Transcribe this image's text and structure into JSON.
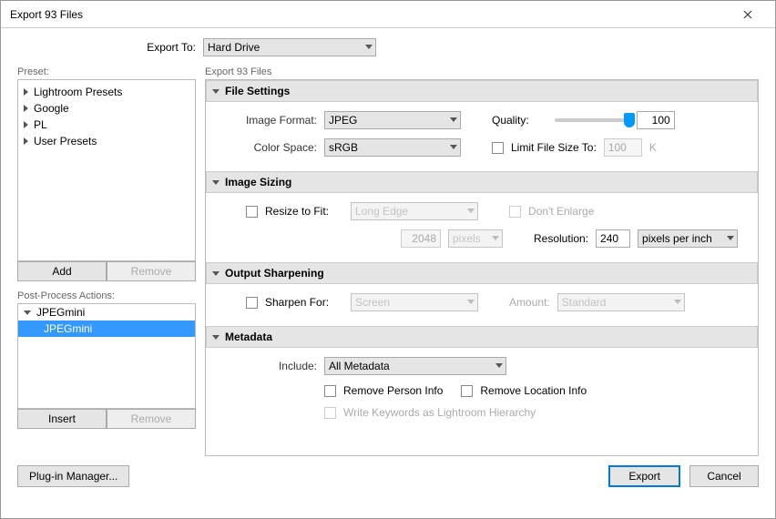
{
  "window": {
    "title": "Export 93 Files"
  },
  "exportTo": {
    "label": "Export To:",
    "value": "Hard Drive"
  },
  "preset": {
    "label": "Preset:",
    "items": [
      "Lightroom Presets",
      "Google",
      "PL",
      "User Presets"
    ],
    "add": "Add",
    "remove": "Remove"
  },
  "actions": {
    "label": "Post-Process Actions:",
    "group": "JPEGmini",
    "child": "JPEGmini",
    "insert": "Insert",
    "remove": "Remove"
  },
  "mainLabel": "Export 93 Files",
  "sections": {
    "fileSettings": {
      "title": "File Settings",
      "imageFormatLabel": "Image Format:",
      "imageFormat": "JPEG",
      "colorSpaceLabel": "Color Space:",
      "colorSpace": "sRGB",
      "qualityLabel": "Quality:",
      "quality": "100",
      "limitLabel": "Limit File Size To:",
      "limitValue": "100",
      "limitUnit": "K"
    },
    "imageSizing": {
      "title": "Image Sizing",
      "resizeLabel": "Resize to Fit:",
      "resizeMode": "Long Edge",
      "dontEnlarge": "Don't Enlarge",
      "dim": "2048",
      "dimUnit": "pixels",
      "resolutionLabel": "Resolution:",
      "resolution": "240",
      "resolutionUnit": "pixels per inch"
    },
    "sharpening": {
      "title": "Output Sharpening",
      "sharpenLabel": "Sharpen For:",
      "sharpenFor": "Screen",
      "amountLabel": "Amount:",
      "amount": "Standard"
    },
    "metadata": {
      "title": "Metadata",
      "includeLabel": "Include:",
      "include": "All Metadata",
      "removePerson": "Remove Person Info",
      "removeLocation": "Remove Location Info",
      "writeKeywords": "Write Keywords as Lightroom Hierarchy"
    }
  },
  "footer": {
    "plugin": "Plug-in Manager...",
    "export": "Export",
    "cancel": "Cancel"
  }
}
